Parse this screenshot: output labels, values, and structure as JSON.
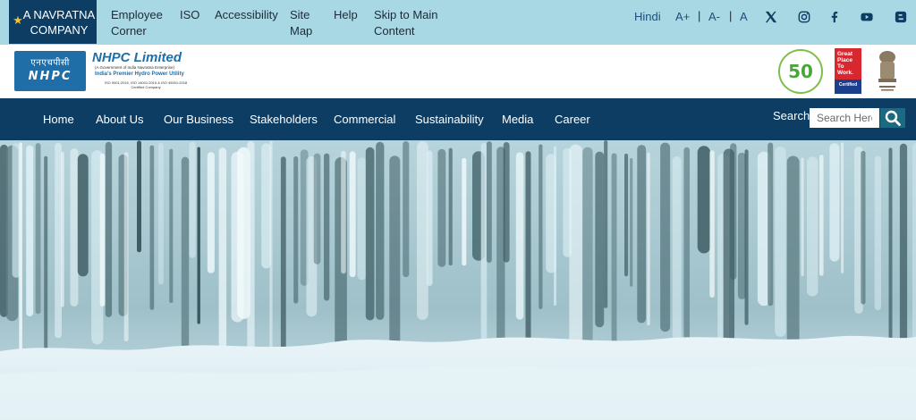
{
  "topbar": {
    "navratna_line1": "A NAVRATNA",
    "navratna_line2": "COMPANY",
    "links": {
      "employee_corner": [
        "Employee",
        "Corner"
      ],
      "iso": "ISO",
      "accessibility": "Accessibility",
      "site_map": [
        "Site",
        "Map"
      ],
      "help": "Help",
      "skip": [
        "Skip to Main",
        "Content"
      ]
    },
    "language": "Hindi",
    "font_controls": {
      "increase": "A+",
      "decrease": "A-",
      "reset": "A",
      "separator": "|"
    },
    "social_icons": [
      "x-icon",
      "instagram-icon",
      "facebook-icon",
      "youtube-icon",
      "blogger-icon"
    ]
  },
  "logobar": {
    "logo_hindi": "एनएचपीसी",
    "logo_english": "NHPC",
    "company_name": "NHPC Limited",
    "tagline_small": "(A Government of India Navratna Enterprise)",
    "tagline": "India's Premier Hydro Power Utility",
    "certifications": "ISO 9001:2015, ISO 14001:2015 & ISO 45001:2018 Certified Company",
    "anniversary_badge": "50",
    "gptw_lines": [
      "Great",
      "Place",
      "To",
      "Work."
    ],
    "gptw_certified": "Certified"
  },
  "nav": {
    "items": [
      "Home",
      "About Us",
      "Our Business",
      "Stakeholders",
      "Commercial",
      "Sustainability",
      "Media",
      "Career"
    ],
    "search_label": "Search:",
    "search_placeholder": "Search Here"
  },
  "colors": {
    "topbar_bg": "#a8d8e3",
    "brand_dark": "#0d3d62",
    "brand_blue": "#1f6ea8",
    "search_button": "#1b6a82"
  }
}
